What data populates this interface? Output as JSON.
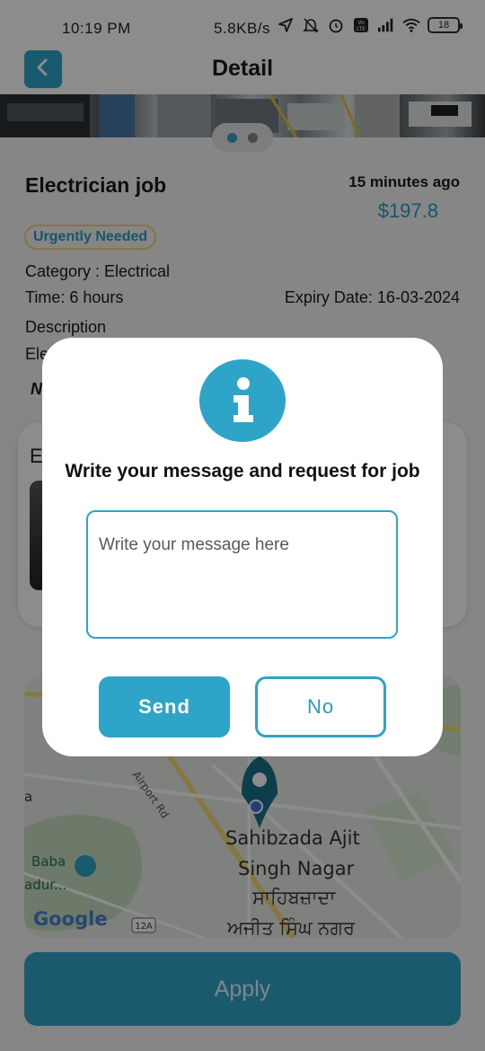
{
  "status_bar": {
    "time": "10:19 PM",
    "network_speed": "5.8KB/s",
    "icons": [
      "location-arrow-icon",
      "mute-icon",
      "alarm-icon",
      "volte-icon",
      "signal-icon",
      "wifi-icon"
    ],
    "battery": "18"
  },
  "header": {
    "title": "Detail",
    "back_icon": "chevron-left-icon"
  },
  "job": {
    "title": "Electrician job",
    "posted_ago": "15 minutes ago",
    "price": "$197.8",
    "badge": "Urgently Needed",
    "category": "Category : Electrical",
    "time": "Time: 6 hours",
    "expiry": "Expiry Date: 16-03-2024",
    "description_label": "Description",
    "description_partial": "Ele",
    "note_partial": "N"
  },
  "card": {
    "title_partial": "E"
  },
  "map": {
    "labels": [
      "Airport Rd",
      "Sahibzada Ajit",
      "Singh Nagar",
      "ਸਾਹਿਬਜ਼ਾਦਾ",
      "ਅਜੀਤ ਸਿੰਘ ਨਗਰ",
      "Baba",
      "adur...",
      "12A",
      "a"
    ],
    "brand": "Google"
  },
  "apply_label": "Apply",
  "dialog": {
    "icon": "info-icon",
    "message": "Write your message and request for job",
    "placeholder": "Write your message here",
    "value": "",
    "send_label": "Send",
    "no_label": "No"
  },
  "colors": {
    "accent": "#2fa4c9",
    "badge_border": "#f1d27a",
    "price": "#2a9cc4"
  }
}
